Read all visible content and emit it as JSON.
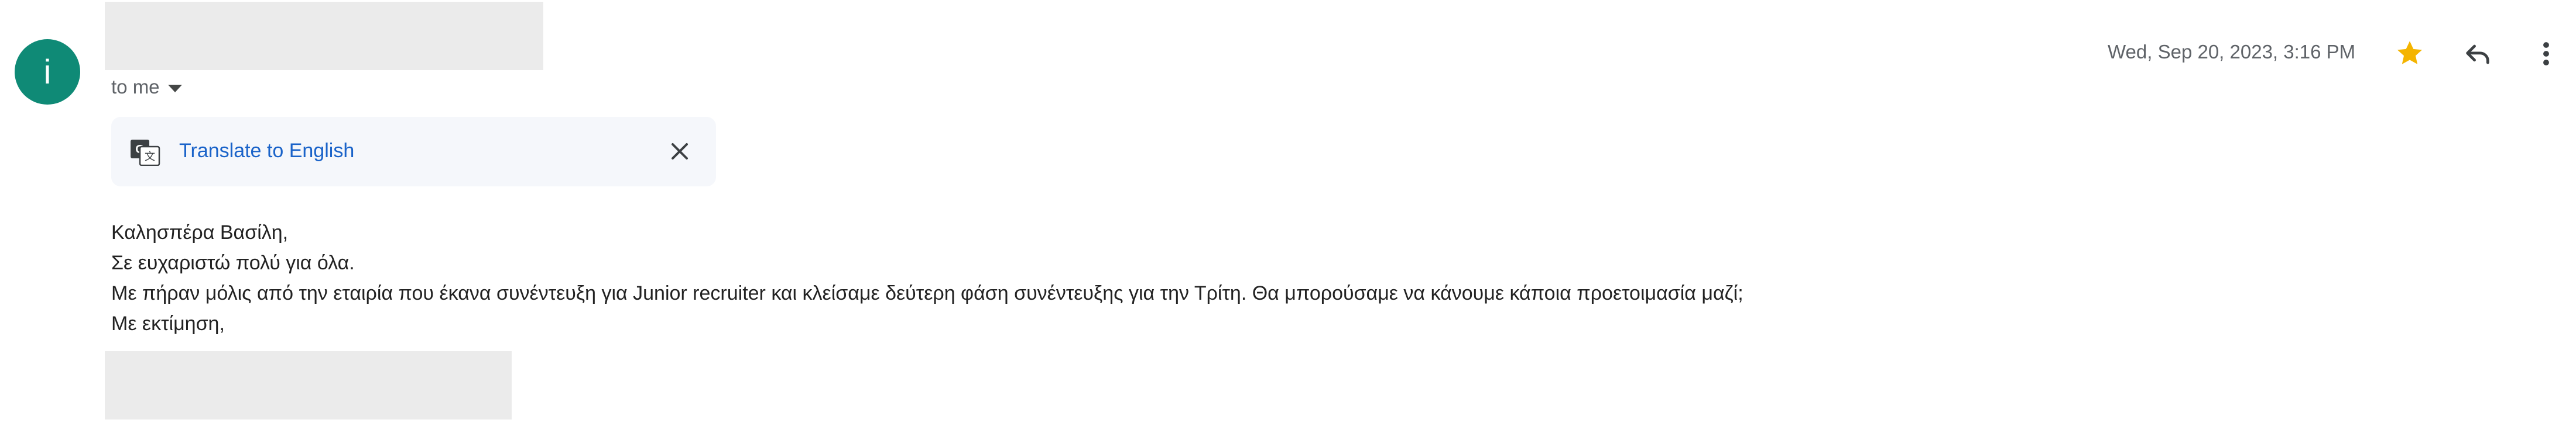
{
  "sender": {
    "avatar_letter": "i",
    "avatar_color": "#0f8a76",
    "recipient_label": "to me"
  },
  "translate_bar": {
    "icon": "translate-icon",
    "link_label": "Translate to English",
    "close_icon": "close-icon"
  },
  "header": {
    "date": "Wed, Sep 20, 2023, 3:16 PM",
    "star_color": "#f4b400",
    "actions": [
      "star-icon",
      "reply-icon",
      "more-vert-icon"
    ]
  },
  "body": {
    "greeting": "Καλησπέρα Βασίλη,",
    "line1": "Σε ευχαριστώ πολύ για όλα.",
    "line2": "Με πήραν μόλις από την εταιρία που έκανα συνέντευξη για Junior recruiter και κλείσαμε δεύτερη φάση συνέντευξης για την Τρίτη.  Θα μπορούσαμε να κάνουμε κάποια προετοιμασία μαζί;",
    "closing": "Με εκτίμηση,"
  }
}
